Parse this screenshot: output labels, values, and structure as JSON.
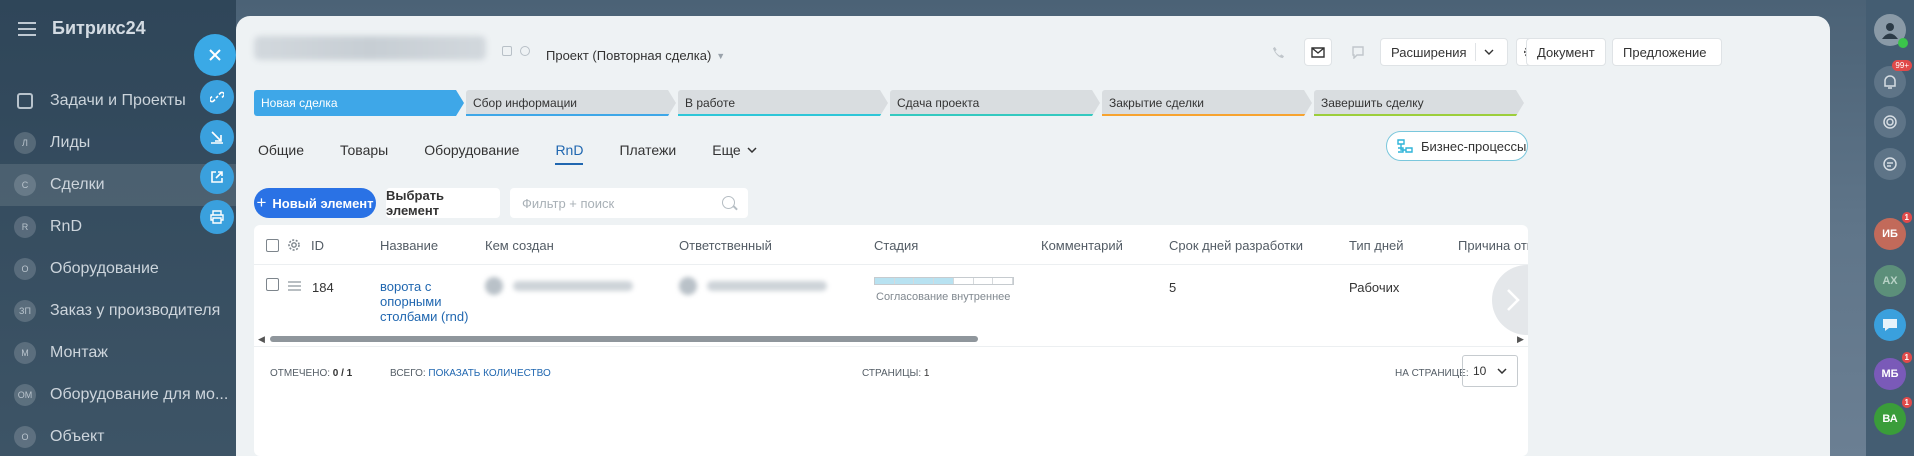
{
  "sidebar": {
    "brand": "Битрикс24",
    "items": [
      {
        "label": "Задачи и Проекты",
        "avatar": ""
      },
      {
        "label": "Лиды",
        "avatar": "Л"
      },
      {
        "label": "Сделки",
        "avatar": "С"
      },
      {
        "label": "RnD",
        "avatar": "R"
      },
      {
        "label": "Оборудование",
        "avatar": "О"
      },
      {
        "label": "Заказ у производителя",
        "avatar": "ЗП"
      },
      {
        "label": "Монтаж",
        "avatar": "М"
      },
      {
        "label": "Оборудование для мо...",
        "avatar": "ОМ"
      },
      {
        "label": "Объект",
        "avatar": "О"
      }
    ]
  },
  "header": {
    "deal_type": "Проект (Повторная сделка)",
    "extensions_label": "Расширения",
    "document_label": "Документ",
    "proposal_label": "Предложение"
  },
  "stages": [
    {
      "label": "Новая сделка",
      "color": "#3ea7e8"
    },
    {
      "label": "Сбор информации",
      "color": "#3ea7e8"
    },
    {
      "label": "В работе",
      "color": "#2ec6d8"
    },
    {
      "label": "Сдача проекта",
      "color": "#34c9c0"
    },
    {
      "label": "Закрытие сделки",
      "color": "#f7a32f"
    },
    {
      "label": "Завершить сделку",
      "color": "#9cce3b"
    }
  ],
  "tabs": [
    "Общие",
    "Товары",
    "Оборудование",
    "RnD",
    "Платежи",
    "Еще"
  ],
  "active_tab": "RnD",
  "business_process_label": "Бизнес-процессы",
  "toolbar": {
    "new_label": "Новый элемент",
    "pick_label": "Выбрать элемент",
    "search_placeholder": "Фильтр + поиск"
  },
  "grid": {
    "columns": [
      "ID",
      "Название",
      "Кем создан",
      "Ответственный",
      "Стадия",
      "Комментарий",
      "Срок дней разработки",
      "Тип дней",
      "Причина отм"
    ],
    "rows": [
      {
        "id": "184",
        "name": [
          "ворота с",
          "опорными",
          "столбами (rnd)"
        ],
        "stage": "Согласование внутреннее",
        "stage_progress": 0.57,
        "dev_days": "5",
        "day_type": "Рабочих"
      }
    ],
    "footer": {
      "checked_label": "ОТМЕЧЕНО:",
      "checked_value": "0 / 1",
      "total_label": "ВСЕГО:",
      "total_link": "ПОКАЗАТЬ КОЛИЧЕСТВО",
      "pages_label": "СТРАНИЦЫ:",
      "pages_value": "1",
      "per_page_label": "НА СТРАНИЦЕ:",
      "per_page_value": "10"
    }
  },
  "rail": {
    "notifications_badge": "99+",
    "users": [
      {
        "initials": "ИБ",
        "badge": "1",
        "color": "#c26a5a"
      },
      {
        "initials": "АХ",
        "badge": "",
        "color": "#5c8f7a"
      },
      {
        "initials": "",
        "badge": "",
        "color": "#3aa0dd"
      },
      {
        "initials": "МБ",
        "badge": "1",
        "color": "#7a5ab8"
      },
      {
        "initials": "ВА",
        "badge": "1",
        "color": "#3a9d3a"
      }
    ]
  }
}
